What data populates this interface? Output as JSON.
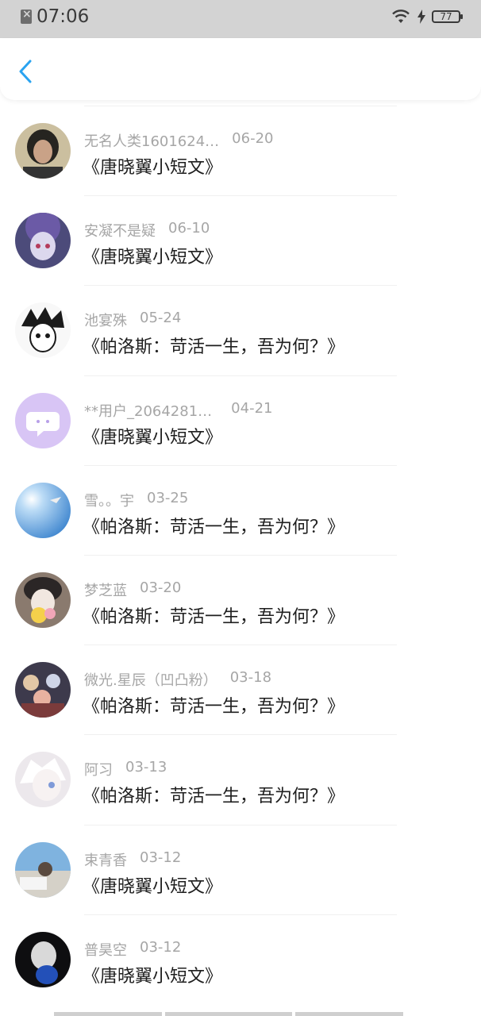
{
  "status_bar": {
    "time": "07:06",
    "battery": "77"
  },
  "header": {
    "back_icon": "chevron-left-icon",
    "accent_color": "#2aa3f0"
  },
  "items": [
    {
      "name": "无名人类1601624…",
      "date": "06-20",
      "title": "《唐晓翼小短文》",
      "avatar": "avatar-photo-woman"
    },
    {
      "name": "安凝不是疑",
      "date": "06-10",
      "title": "《唐晓翼小短文》",
      "avatar": "avatar-anime-purple"
    },
    {
      "name": "池宴殊",
      "date": "05-24",
      "title": "《帕洛斯：苛活一生，吾为何？》",
      "avatar": "avatar-sketch"
    },
    {
      "name": "**用户_2064281…",
      "date": "04-21",
      "title": "《唐晓翼小短文》",
      "avatar": "avatar-default-chat"
    },
    {
      "name": "雪。。宇",
      "date": "03-25",
      "title": "《帕洛斯：苛活一生，吾为何？》",
      "avatar": "avatar-sky"
    },
    {
      "name": "梦芝蓝",
      "date": "03-20",
      "title": "《帕洛斯：苛活一生，吾为何？》",
      "avatar": "avatar-anime-flower"
    },
    {
      "name": "微光.星辰（凹凸粉）",
      "date": "03-18",
      "title": "《帕洛斯：苛活一生，吾为何？》",
      "avatar": "avatar-anime-group"
    },
    {
      "name": "阿习",
      "date": "03-13",
      "title": "《帕洛斯：苛活一生，吾为何？》",
      "avatar": "avatar-anime-white"
    },
    {
      "name": "束青香",
      "date": "03-12",
      "title": "《唐晓翼小短文》",
      "avatar": "avatar-photo-car"
    },
    {
      "name": "普昊空",
      "date": "03-12",
      "title": "《唐晓翼小短文》",
      "avatar": "avatar-dark"
    }
  ]
}
